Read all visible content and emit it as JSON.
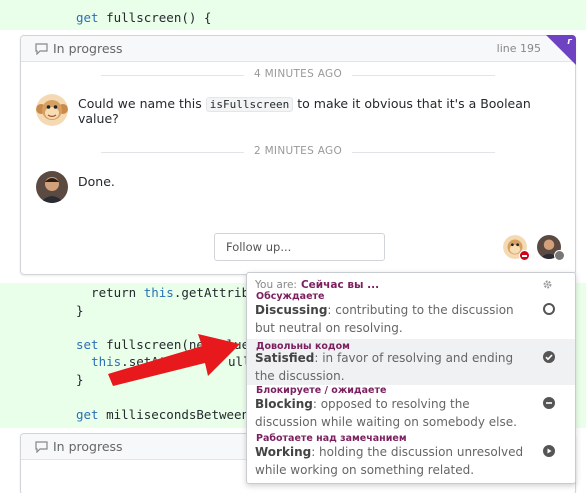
{
  "code_top": {
    "line1_kw": "get",
    "line1_rest": " fullscreen() {"
  },
  "thread1": {
    "status": "In progress",
    "line_ref": "line 195",
    "corner_label": "г",
    "ts1": "4 MINUTES AGO",
    "msg1_pre": "Could we name this ",
    "msg1_code": "isFullscreen",
    "msg1_post": " to make it obvious that it's a Boolean value?",
    "ts2": "2 MINUTES AGO",
    "msg2": "Done.",
    "followup_placeholder": "Follow up..."
  },
  "code_mid": {
    "l1_a": "  return ",
    "l1_kw": "this",
    "l1_b": ".getAttribut",
    "l2": "}",
    "l3_kw": "set",
    "l3_b": " fullscreen(newValue)",
    "l4_a": "  ",
    "l4_kw": "this",
    "l4_b": ".setAttri",
    "l4_c": "ull",
    "l5": "}",
    "l6_kw": "get",
    "l6_b": " millisecondsBetweenMo"
  },
  "thread2": {
    "status": "In progress"
  },
  "popup": {
    "you_are": "You are:",
    "you_are_ru": "Сейчас вы ...",
    "options": [
      {
        "ru": "Обсуждаете",
        "title": "Discussing",
        "desc": ": contributing to the discussion but neutral on resolving.",
        "icon": "empty-circle-icon"
      },
      {
        "ru": "Довольны кодом",
        "title": "Satisfied",
        "desc": ": in favor of resolving and ending the discussion.",
        "icon": "check-circle-icon"
      },
      {
        "ru": "Блокируете / ожидаете",
        "title": "Blocking",
        "desc": ": opposed to resolving the discussion while waiting on somebody else.",
        "icon": "minus-circle-icon"
      },
      {
        "ru": "Работаете над замечанием",
        "title": "Working",
        "desc": ": holding the discussion unresolved while working on something related.",
        "icon": "play-circle-icon"
      }
    ]
  },
  "colors": {
    "accent": "#6f42c1",
    "ru_label": "#7b1f5f",
    "arrow": "#e8191c",
    "code_bg": "#eaffea"
  }
}
